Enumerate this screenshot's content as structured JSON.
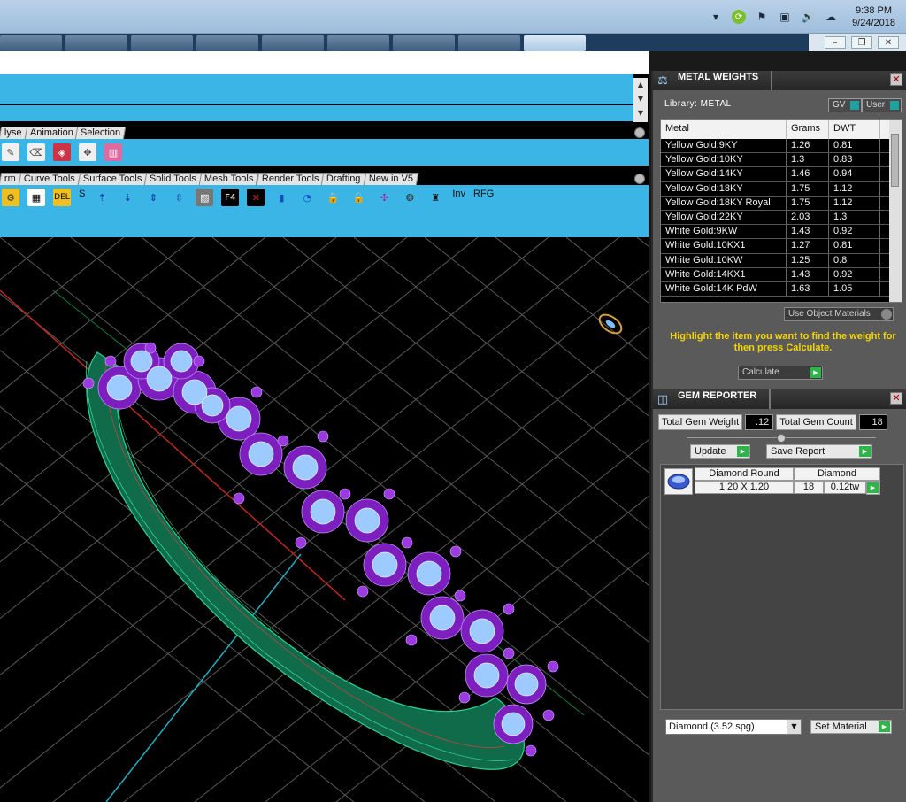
{
  "tray": {
    "icons": [
      "chevron-up-icon",
      "sync-icon",
      "flag-icon",
      "network-icon",
      "speaker-icon",
      "cloud-icon"
    ],
    "time": "9:38 PM",
    "date": "9/24/2018"
  },
  "toolbar_tabs_row1": [
    "lyse",
    "Animation",
    "Selection"
  ],
  "toolbar_tabs_row2": [
    "rm",
    "Curve Tools",
    "Surface Tools",
    "Solid Tools",
    "Mesh Tools",
    "Render Tools",
    "Drafting",
    "New in V5"
  ],
  "toolbar_row2_labels": {
    "s": "S",
    "inv": "Inv",
    "rfg": "RFG"
  },
  "metal_weights": {
    "title": "METAL WEIGHTS",
    "library_label": "Library: METAL",
    "gv_label": "GV",
    "user_label": "User",
    "columns": [
      "Metal",
      "Grams",
      "DWT"
    ],
    "rows": [
      [
        "Yellow Gold:9KY",
        "1.26",
        "0.81"
      ],
      [
        "Yellow Gold:10KY",
        "1.3",
        "0.83"
      ],
      [
        "Yellow Gold:14KY",
        "1.46",
        "0.94"
      ],
      [
        "Yellow Gold:18KY",
        "1.75",
        "1.12"
      ],
      [
        "Yellow Gold:18KY Royal",
        "1.75",
        "1.12"
      ],
      [
        "Yellow Gold:22KY",
        "2.03",
        "1.3"
      ],
      [
        "White Gold:9KW",
        "1.43",
        "0.92"
      ],
      [
        "White Gold:10KX1",
        "1.27",
        "0.81"
      ],
      [
        "White Gold:10KW",
        "1.25",
        "0.8"
      ],
      [
        "White Gold:14KX1",
        "1.43",
        "0.92"
      ],
      [
        "White Gold:14K PdW",
        "1.63",
        "1.05"
      ]
    ],
    "use_object_materials": "Use Object Materials",
    "hint": "Highlight the item you want to find the weight for then press Calculate.",
    "calculate_label": "Calculate"
  },
  "gem_reporter": {
    "title": "GEM REPORTER",
    "total_weight_label": "Total Gem Weight",
    "total_weight_value": ".12",
    "total_count_label": "Total Gem Count",
    "total_count_value": "18",
    "update_label": "Update",
    "save_report_label": "Save Report",
    "gem": {
      "shape": "Diamond Round",
      "material": "Diamond",
      "size": "1.20 X 1.20",
      "count": "18",
      "weight": "0.12tw"
    },
    "material_select": "Diamond     (3.52 spg)",
    "set_material_label": "Set Material"
  },
  "colors": {
    "toolbar_blue": "#3bb4e6",
    "panel_gray": "#5a5a5a",
    "hint_yellow": "#f5d400",
    "prong_purple": "#8a2be2",
    "band_green": "#1f9e6e",
    "stone_blue": "#9ecbff"
  }
}
